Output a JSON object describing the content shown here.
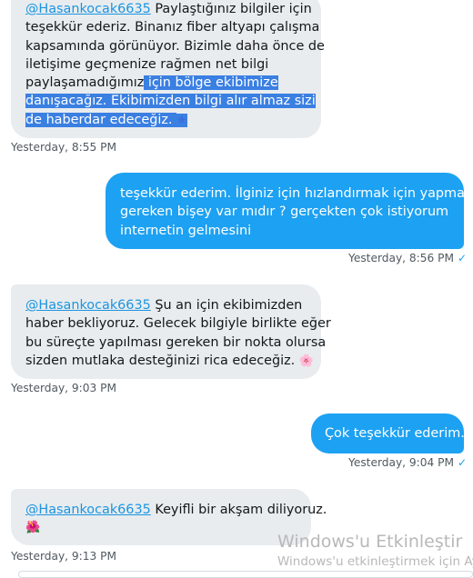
{
  "messages": [
    {
      "mention": "@Hasankocak6635",
      "line1_rest": " Paylaştığınız bilgiler için",
      "line2": "teşekkür ederiz. Binanız fiber altyapı çalışma",
      "line3": "kapsamında görünüyor. Bizimle daha önce de",
      "line4": "iletişime geçmenize rağmen net bilgi",
      "line5_plain": "paylaşamadığımız",
      "line5_sel": " için bölge ekibimize",
      "line6_sel": "danışacağız. Ekibimizden bilgi alır almaz sizi",
      "line7_sel": "de haberdar edeceğiz. ",
      "emoji": "★",
      "time": "Yesterday, 8:55 PM"
    },
    {
      "line1": "teşekkür ederim. İlginiz için hızlandırmak için yapmam",
      "line2": "gereken bişey var mıdır ? gerçekten çok istiyorum",
      "line3": "internetin gelmesini",
      "time": "Yesterday, 8:56 PM",
      "check": "✓"
    },
    {
      "mention": "@Hasankocak6635",
      "line1_rest": " Şu an için ekibimizden",
      "line2": "haber bekliyoruz. Gelecek bilgiyle birlikte eğer",
      "line3": "bu süreçte yapılması gereken bir nokta olursa",
      "line4": "sizden mutlaka desteğinizi rica edeceğiz. ",
      "emoji": "🌸",
      "time": "Yesterday, 9:03 PM"
    },
    {
      "line1": "Çok teşekkür ederim.",
      "time": "Yesterday, 9:04 PM",
      "check": "✓"
    },
    {
      "mention": "@Hasankocak6635",
      "line1_rest": " Keyifli bir akşam diliyoruz.",
      "emoji": "🌺",
      "time": "Yesterday, 9:13 PM"
    }
  ],
  "watermark": {
    "title": "Windows'u Etkinleştir",
    "subtitle": "Windows'u etkinleştirmek için Ay"
  },
  "colors": {
    "incoming_bubble": "#e8ecef",
    "outgoing_bubble": "#1da1f2",
    "mention": "#1b95e0",
    "selection": "#3a7fe2"
  }
}
